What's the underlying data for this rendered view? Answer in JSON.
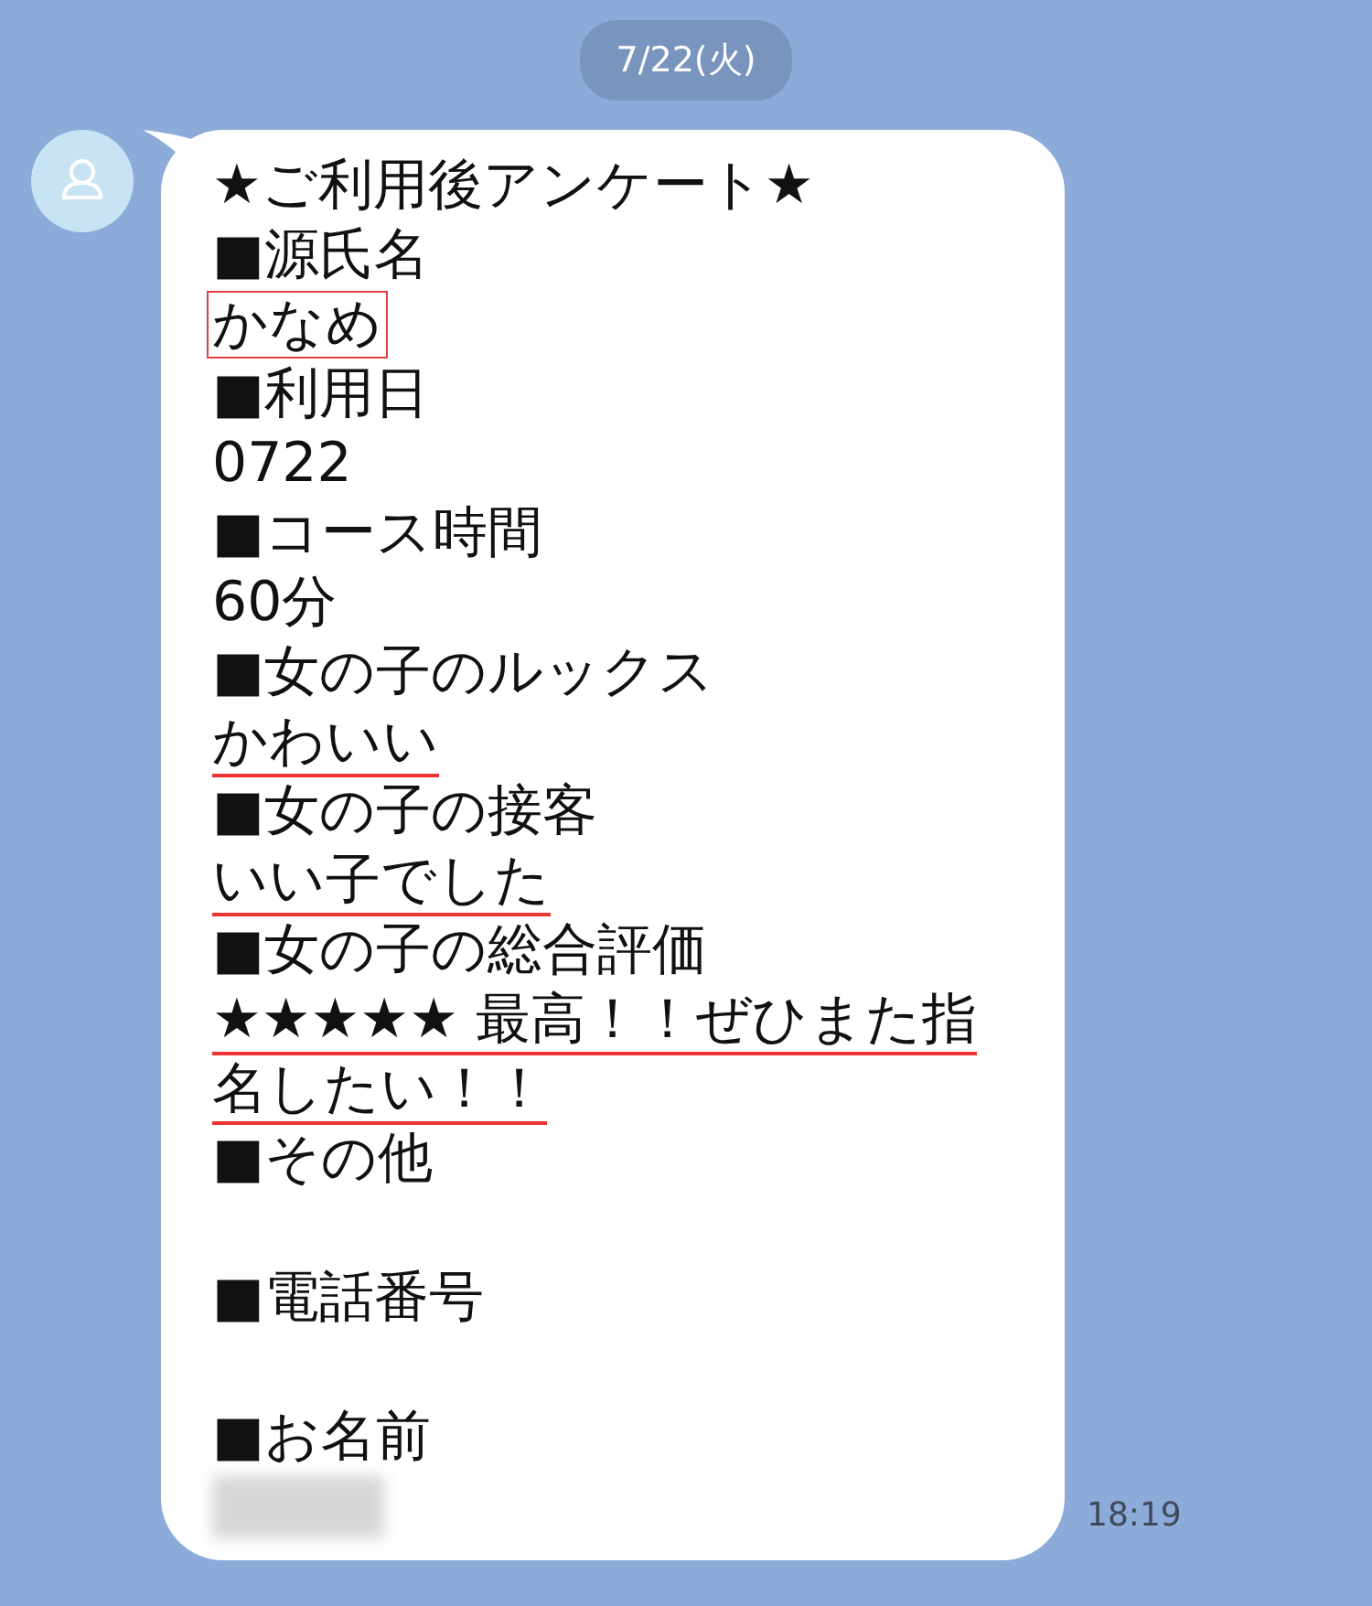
{
  "date_chip": "7/22(火)",
  "message": {
    "lines": [
      {
        "kind": "text",
        "text": "★ご利用後アンケート★",
        "boxed": false,
        "underlined": false
      },
      {
        "kind": "text",
        "text": "■源氏名",
        "boxed": false,
        "underlined": false
      },
      {
        "kind": "text",
        "text": "かなめ",
        "boxed": true,
        "underlined": false
      },
      {
        "kind": "text",
        "text": "■利用日",
        "boxed": false,
        "underlined": false
      },
      {
        "kind": "text",
        "text": "0722",
        "boxed": false,
        "underlined": false
      },
      {
        "kind": "text",
        "text": "■コース時間",
        "boxed": false,
        "underlined": false
      },
      {
        "kind": "text",
        "text": "60分",
        "boxed": false,
        "underlined": false
      },
      {
        "kind": "text",
        "text": "■女の子のルックス",
        "boxed": false,
        "underlined": false
      },
      {
        "kind": "text",
        "text": "かわいい",
        "boxed": false,
        "underlined": true
      },
      {
        "kind": "text",
        "text": "■女の子の接客",
        "boxed": false,
        "underlined": false
      },
      {
        "kind": "text",
        "text": "いい子でした",
        "boxed": false,
        "underlined": true
      },
      {
        "kind": "text",
        "text": "■女の子の総合評価",
        "boxed": false,
        "underlined": false
      },
      {
        "kind": "text",
        "text": "★★★★★ 最高！！ぜひまた指名したい！！",
        "boxed": false,
        "underlined": true
      },
      {
        "kind": "text",
        "text": "■その他",
        "boxed": false,
        "underlined": false
      },
      {
        "kind": "blank"
      },
      {
        "kind": "text",
        "text": "■電話番号",
        "boxed": false,
        "underlined": false
      },
      {
        "kind": "blank"
      },
      {
        "kind": "text",
        "text": "■お名前",
        "boxed": false,
        "underlined": false
      },
      {
        "kind": "redacted"
      }
    ],
    "time": "18:19"
  }
}
